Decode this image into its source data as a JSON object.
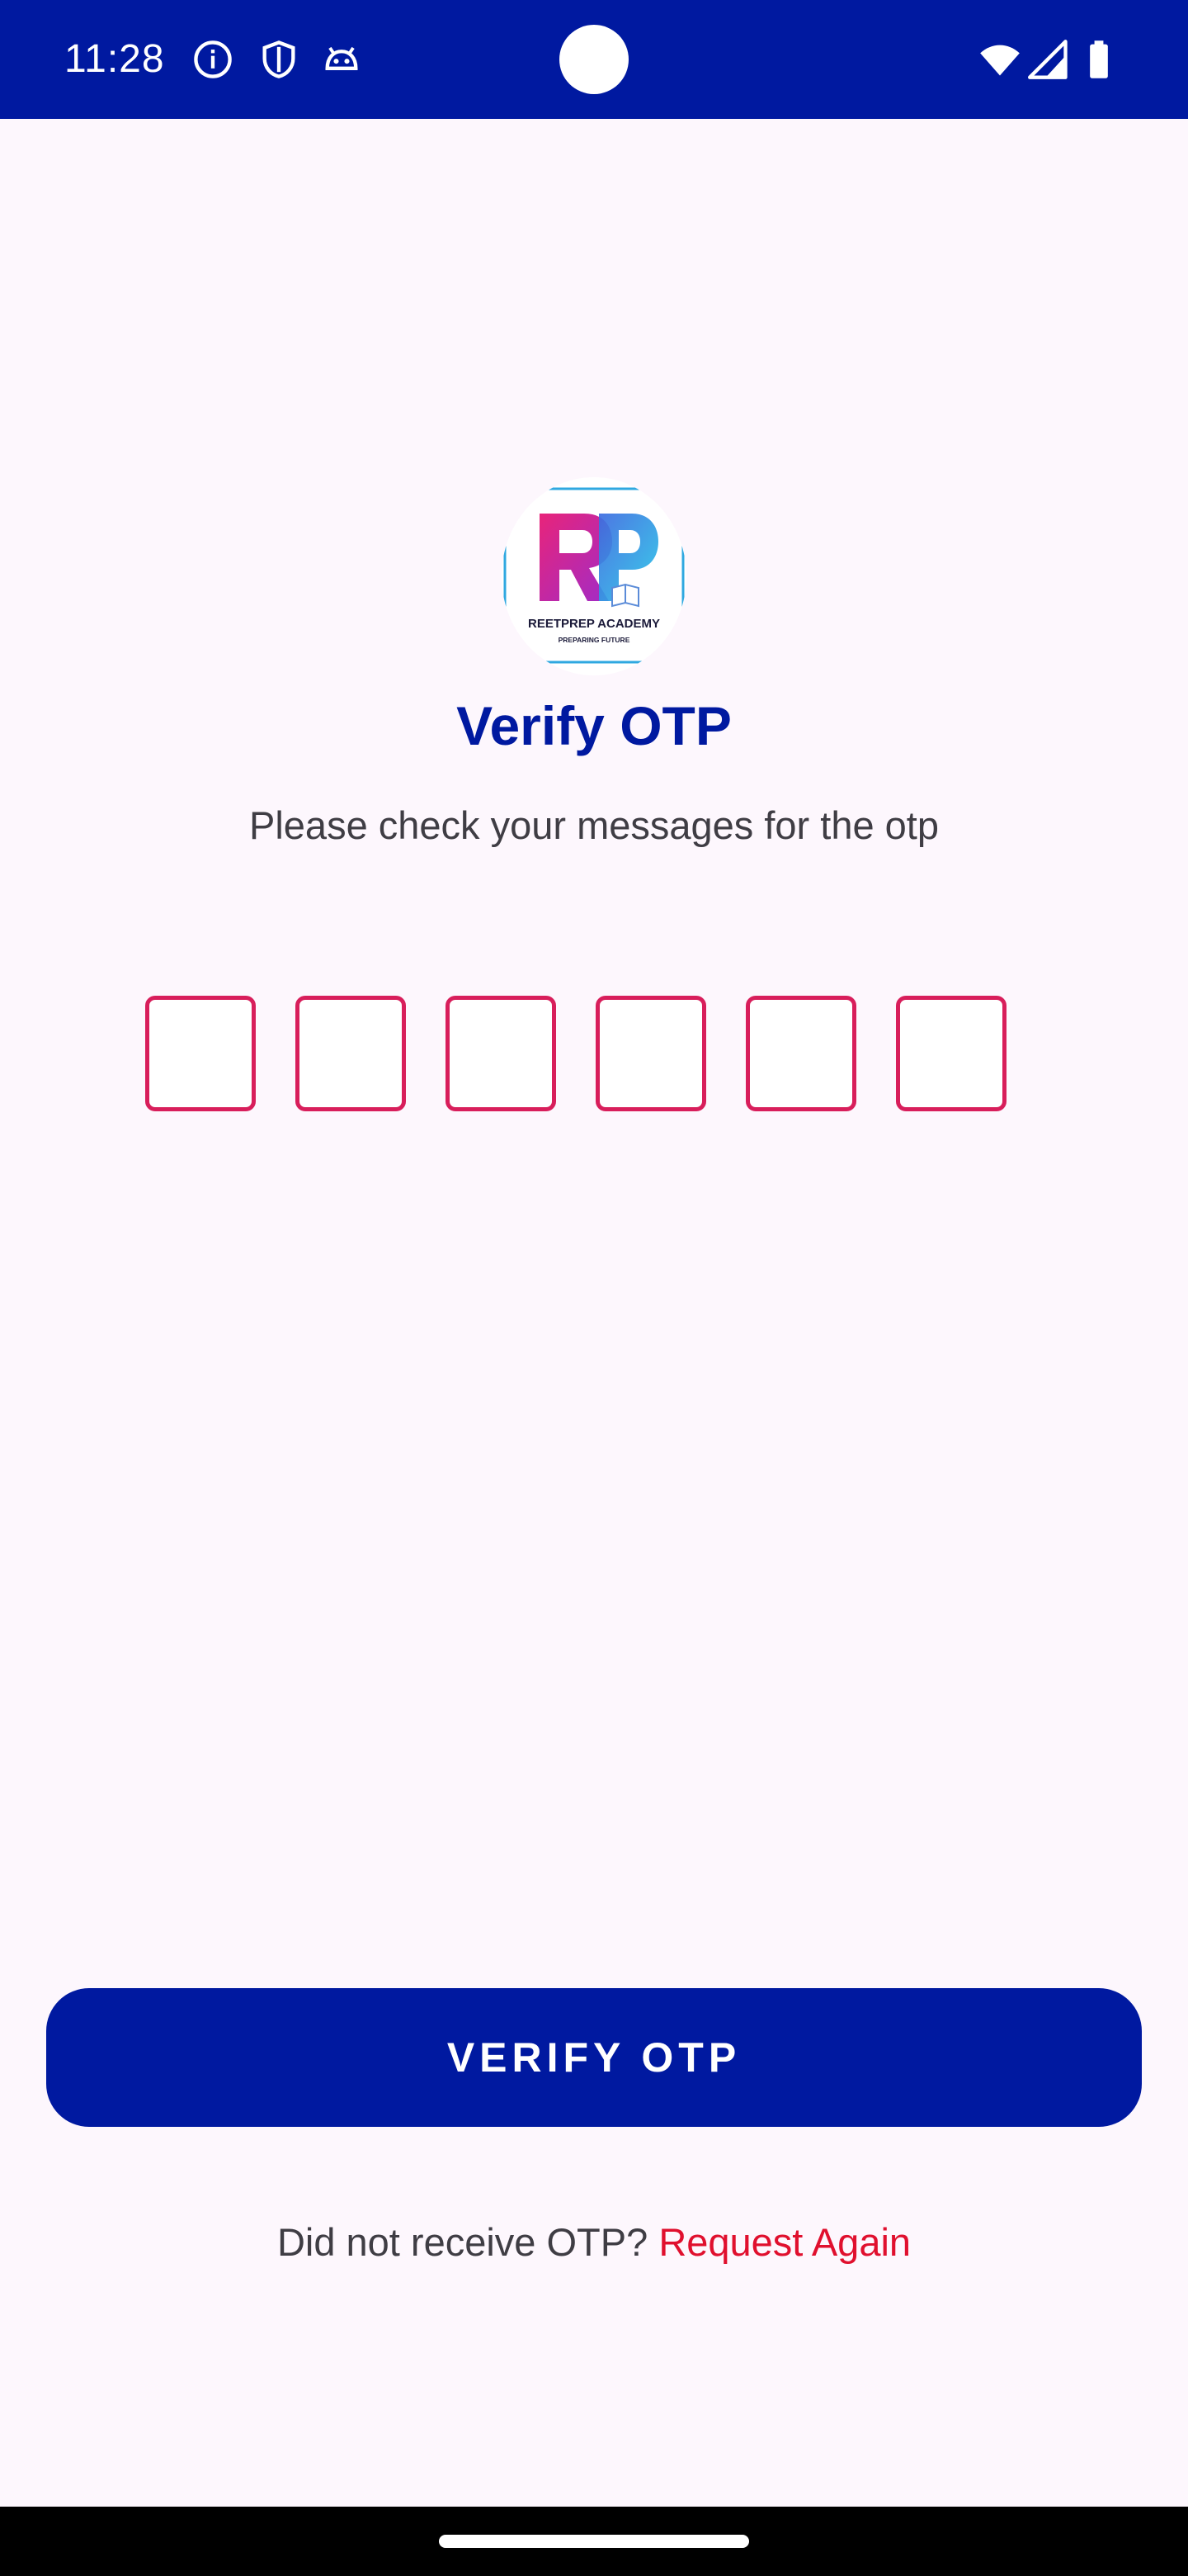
{
  "status_bar": {
    "time": "11:28",
    "background_color": "#0019A0",
    "left_icons": [
      "info-icon",
      "shield-icon",
      "android-icon"
    ],
    "right_icons": [
      "wifi-icon",
      "cell-signal-icon",
      "battery-icon"
    ]
  },
  "logo": {
    "brand_name": "REETPREP ACADEMY",
    "tagline": "PREPARING FUTURE",
    "monogram": "RP"
  },
  "header": {
    "title": "Verify OTP",
    "subtitle": "Please check your messages for the otp"
  },
  "otp": {
    "digit_count": 6,
    "digits": [
      "",
      "",
      "",
      "",
      "",
      ""
    ],
    "border_color": "#D81E5B"
  },
  "actions": {
    "verify_label": "VERIFY OTP",
    "resend_prompt": "Did not receive OTP?",
    "resend_link": "Request Again"
  },
  "colors": {
    "primary": "#0019A0",
    "accent": "#D81E5B",
    "link": "#E0102E",
    "background": "#FDF7FD"
  }
}
